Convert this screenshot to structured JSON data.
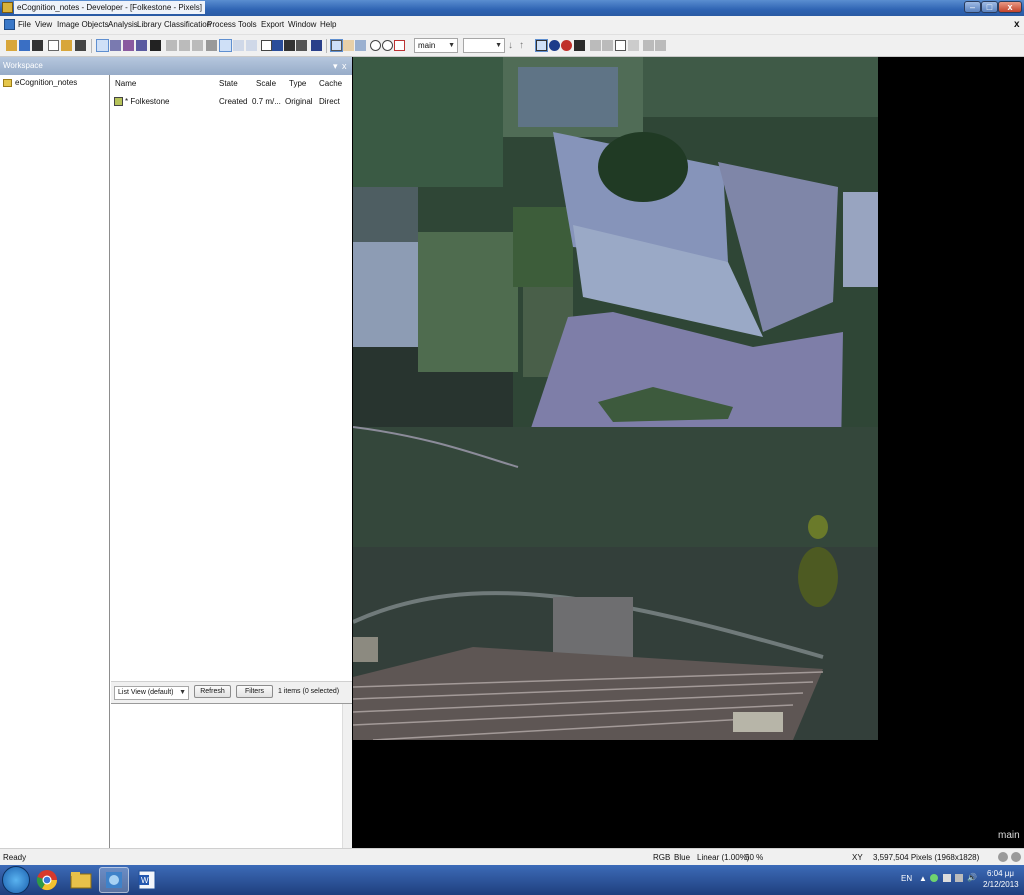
{
  "window": {
    "title": "eCognition_notes - Developer - [Folkestone - Pixels]",
    "minimize": "–",
    "maximize": "□",
    "close": "x"
  },
  "menubar": {
    "items": [
      "File",
      "View",
      "Image Objects",
      "Analysis",
      "Library",
      "Classification",
      "Process",
      "Tools",
      "Export",
      "Window",
      "Help"
    ],
    "close_doc": "x"
  },
  "toolbar": {
    "map_combo": "main",
    "second_combo": ""
  },
  "workspace": {
    "header": "Workspace",
    "header_buttons": [
      "▾",
      "x"
    ],
    "tree": {
      "root": "eCognition_notes"
    },
    "columns": [
      "Name",
      "State",
      "Scale",
      "Type",
      "Cache"
    ],
    "rows": [
      {
        "name": "* Folkestone",
        "state": "Created",
        "scale": "0.7 m/...",
        "type": "Original",
        "cache": "Direct"
      }
    ],
    "view_select": "List View (default)",
    "refresh_button": "Refresh",
    "filters_button": "Filters",
    "item_count": "1 items (0 selected)"
  },
  "image_view": {
    "map_label": "main"
  },
  "statusbar": {
    "ready": "Ready",
    "rgb": "RGB",
    "band": "Blue",
    "stretch": "Linear (1.00%)",
    "zoom": "50 %",
    "xy": "XY",
    "pixels": "3,597,504 Pixels (1968x1828)"
  },
  "taskbar": {
    "tray_lang": "EN",
    "time": "6:04 μμ",
    "date": "2/12/2013"
  },
  "colors": {
    "title_bar": "#2f64b3",
    "taskbar": "#1f3f7d",
    "workspace_header": "#a9bcd6"
  }
}
